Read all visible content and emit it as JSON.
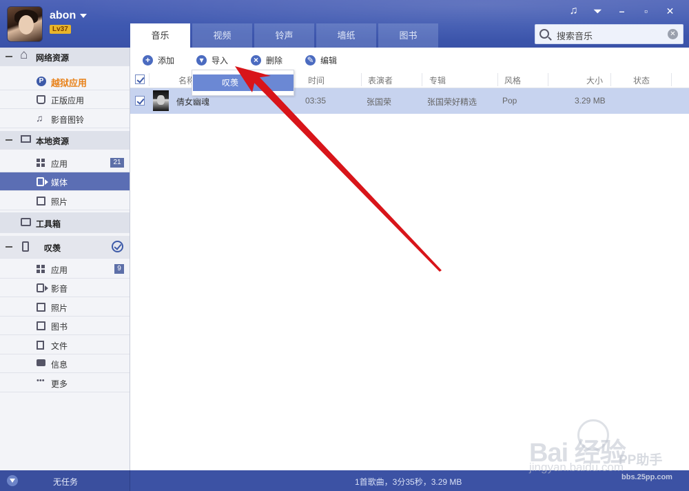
{
  "user": {
    "name": "abon",
    "level": "Lv37"
  },
  "tabs": [
    {
      "label": "音乐",
      "active": true
    },
    {
      "label": "视频",
      "active": false
    },
    {
      "label": "铃声",
      "active": false
    },
    {
      "label": "墙纸",
      "active": false
    },
    {
      "label": "图书",
      "active": false
    }
  ],
  "search": {
    "placeholder": "搜索音乐"
  },
  "window_controls": {
    "music": "♫",
    "menu": "⏷",
    "minimize": "–",
    "maximize": "▫",
    "close": "✕"
  },
  "sidebar": {
    "network": {
      "label": "网络资源",
      "items": [
        {
          "label": "越狱应用"
        },
        {
          "label": "正版应用"
        },
        {
          "label": "影音图铃"
        }
      ]
    },
    "local": {
      "label": "本地资源",
      "items": [
        {
          "label": "应用",
          "badge": "21"
        },
        {
          "label": "媒体"
        },
        {
          "label": "照片"
        }
      ]
    },
    "toolbox": {
      "label": "工具箱"
    },
    "device": {
      "label": "叹羡",
      "items": [
        {
          "label": "应用",
          "badge": "9"
        },
        {
          "label": "影音"
        },
        {
          "label": "照片"
        },
        {
          "label": "图书"
        },
        {
          "label": "文件"
        },
        {
          "label": "信息"
        },
        {
          "label": "更多"
        }
      ]
    }
  },
  "toolbar": {
    "add": "添加",
    "import": "导入",
    "delete": "删除",
    "edit": "编辑"
  },
  "import_dropdown": {
    "item": "叹羡"
  },
  "table": {
    "columns": {
      "name": "名称",
      "time": "时间",
      "artist": "表演者",
      "album": "专辑",
      "genre": "风格",
      "size": "大小",
      "status": "状态"
    },
    "rows": [
      {
        "name": "倩女幽魂",
        "time": "03:35",
        "artist": "张国荣",
        "album": "张国荣好精选",
        "genre": "Pop",
        "size": "3.29 MB",
        "status": "",
        "checked": true
      }
    ]
  },
  "footer": {
    "task": "无任务",
    "summary": "1首歌曲，3分35秒，3.29 MB"
  },
  "watermark": {
    "brand": "Bai  经验",
    "url": "jingyan.baidu.com",
    "pp": "PP助手",
    "site": "bbs.25pp.com"
  },
  "colors": {
    "header": "#3e58b0",
    "selected_nav": "#5b6eb4",
    "selected_row": "#c7d3ef",
    "accent_orange": "#e8821a",
    "arrow": "#d8151a"
  }
}
